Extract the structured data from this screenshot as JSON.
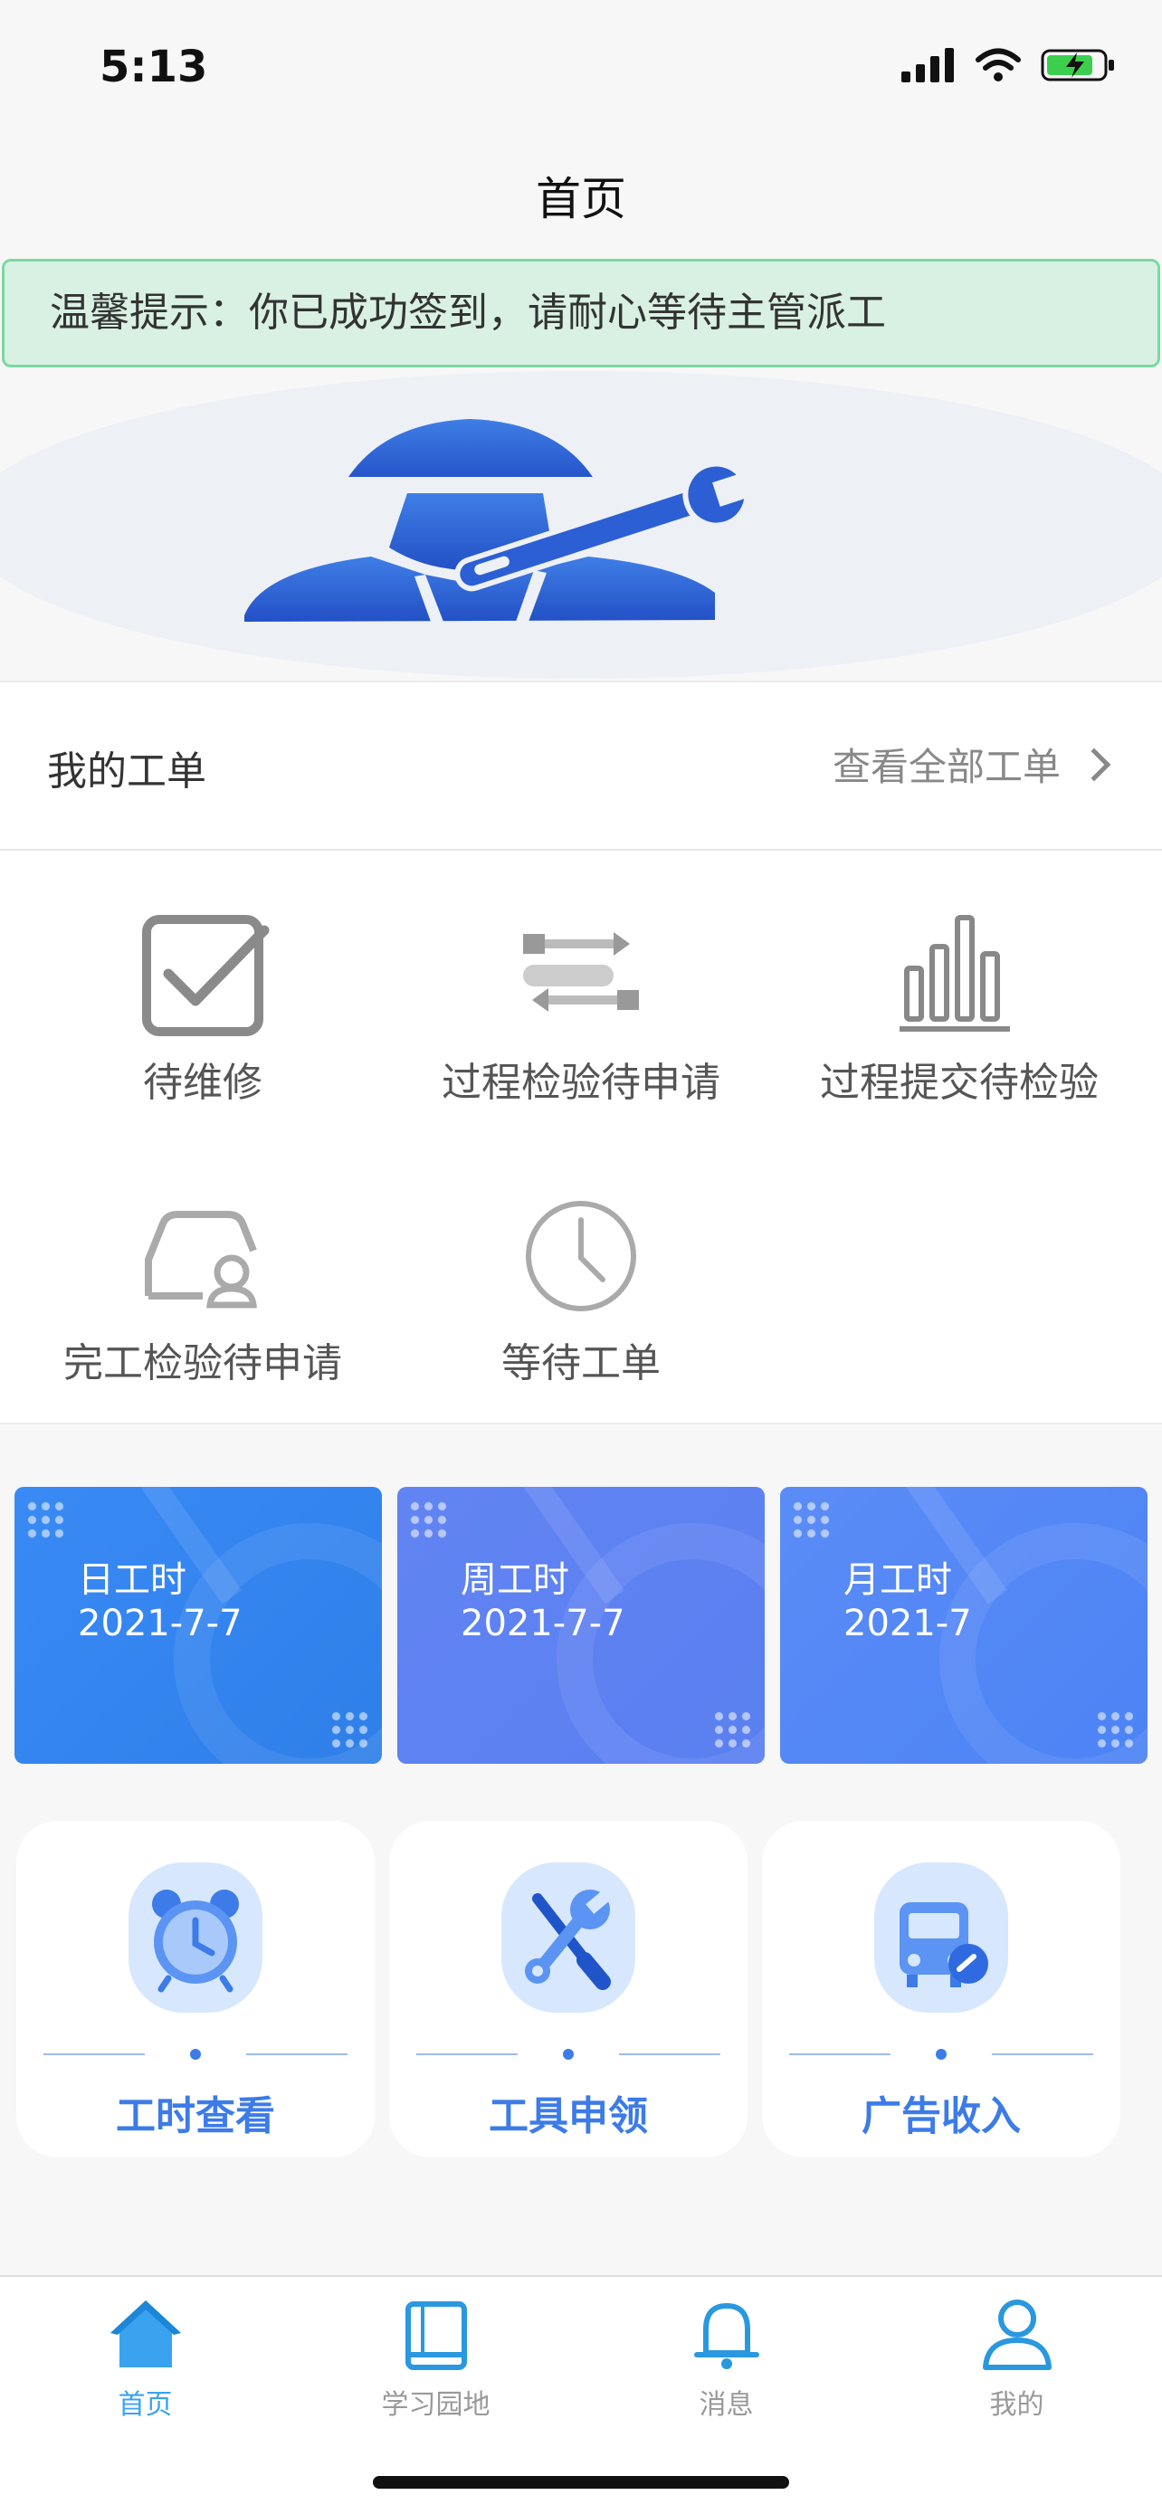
{
  "status_bar": {
    "time": "5:13"
  },
  "nav": {
    "title": "首页"
  },
  "notice": {
    "text": "温馨提示：你已成功签到，请耐心等待主管派工"
  },
  "work_orders": {
    "title": "我的工单",
    "view_all": "查看全部工单",
    "items": [
      {
        "label": "待维修",
        "icon": "checkbox-icon"
      },
      {
        "label": "过程检验待申请",
        "icon": "process-flow-icon"
      },
      {
        "label": "过程提交待检验",
        "icon": "bar-chart-icon"
      },
      {
        "label": "完工检验待申请",
        "icon": "car-inspect-icon"
      },
      {
        "label": "等待工单",
        "icon": "clock-icon"
      }
    ]
  },
  "stats": [
    {
      "label": "日工时",
      "value": "2021-7-7"
    },
    {
      "label": "周工时",
      "value": "2021-7-7"
    },
    {
      "label": "月工时",
      "value": "2021-7"
    }
  ],
  "quick_tiles": [
    {
      "label": "工时查看",
      "icon": "alarm-clock-icon"
    },
    {
      "label": "工具申领",
      "icon": "tools-icon"
    },
    {
      "label": "广告收入",
      "icon": "bus-icon"
    }
  ],
  "tabbar": {
    "items": [
      {
        "label": "首页",
        "icon": "home-icon",
        "active": true
      },
      {
        "label": "学习园地",
        "icon": "book-icon",
        "active": false
      },
      {
        "label": "消息",
        "icon": "bell-icon",
        "active": false
      },
      {
        "label": "我的",
        "icon": "person-icon",
        "active": false
      }
    ]
  },
  "colors": {
    "accent": "#3c7be8",
    "notice_bg": "#d9f1e2",
    "notice_border": "#7bd9a3",
    "stat_day": "#3b8df5",
    "stat_week": "#5c82f2",
    "stat_month": "#4f86f6",
    "tab_active": "#3aa3f0"
  }
}
